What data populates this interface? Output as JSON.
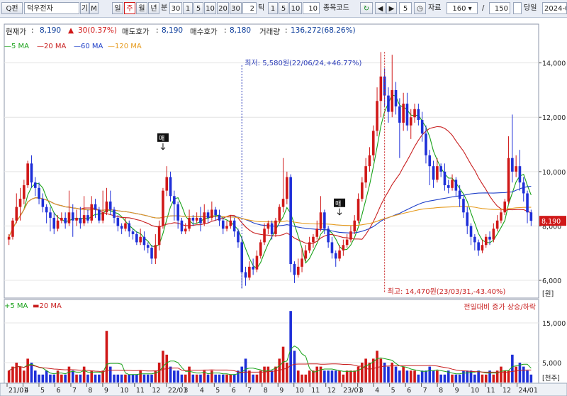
{
  "toolbar": {
    "search_icon_label": "Q펀",
    "stock_name": "덕우전자",
    "btn_gi": "기",
    "btn_m": "M",
    "periods": [
      "일",
      "주",
      "월",
      "년"
    ],
    "active_period": "주",
    "minute_label": "분",
    "minute_value": "30",
    "minute_buttons": [
      "1",
      "5",
      "10",
      "20",
      "30"
    ],
    "tick_value": "2",
    "tick_label": "틱",
    "tick_buttons": [
      "1",
      "5",
      "10"
    ],
    "code_label": "종목코드",
    "step_value": "5",
    "data_label": "자료",
    "data_count": "160",
    "slash": "/",
    "total_count": "150",
    "today_label": "당일",
    "date_value": "2024-0"
  },
  "info": {
    "price_label": "현재가",
    "price_value": "8,190",
    "change_value": "30(0.37%)",
    "ask_label": "매도호가",
    "ask_value": "8,190",
    "bid_label": "매수호가",
    "bid_value": "8,180",
    "volume_label": "거래량",
    "volume_value": "136,272(68.26%)"
  },
  "ma_legend": [
    {
      "label": "5 MA",
      "color": "#1aa21a"
    },
    {
      "label": "20 MA",
      "color": "#c81e1e"
    },
    {
      "label": "60 MA",
      "color": "#1e3fc8"
    },
    {
      "label": "120 MA",
      "color": "#e69b1e"
    }
  ],
  "volume_legend": [
    {
      "label": "5 MA",
      "color": "#1aa21a"
    },
    {
      "label": "20 MA",
      "color": "#c81e1e"
    }
  ],
  "annotations": {
    "low": "최저: 5,580원(22/06/24,+46.77%)",
    "high": "최고: 14,470원(23/03/31,-43.40%)",
    "volume_note": "전일대비 증가 상승/하락",
    "marker": "매"
  },
  "price_axis": {
    "ticks": [
      "14,000",
      "12,000",
      "10,000",
      "8,000",
      "6,000"
    ],
    "unit": "[원]",
    "current": "8,190"
  },
  "volume_axis": {
    "ticks": [
      "15,000",
      "5,000"
    ],
    "unit": "[천주]"
  },
  "x_labels": [
    "21/01",
    "4",
    "5",
    "6",
    "7",
    "8",
    "9",
    "10",
    "11",
    "12",
    "22/01",
    "3",
    "4",
    "5",
    "6",
    "7",
    "8",
    "9",
    "10",
    "11",
    "12",
    "23/01",
    "3",
    "4",
    "5",
    "6",
    "7",
    "8",
    "9",
    "10",
    "11",
    "12",
    "24/01"
  ],
  "colors": {
    "up": "#d01818",
    "down": "#1e2fd8",
    "panel_border": "#8c96a8"
  },
  "chart_data": {
    "type": "candlestick",
    "ylim": [
      5400,
      14800
    ],
    "price_ticks": [
      14000,
      12000,
      10000,
      8000,
      6000
    ],
    "current_price": 8190,
    "candles": [
      [
        7500,
        7600,
        7300,
        7700
      ],
      [
        7600,
        8200,
        7500,
        8300
      ],
      [
        8200,
        8700,
        8100,
        9200
      ],
      [
        8700,
        9000,
        8200,
        9400
      ],
      [
        9000,
        9500,
        8800,
        9700
      ],
      [
        9500,
        10300,
        9400,
        10400
      ],
      [
        10300,
        9600,
        9400,
        10600
      ],
      [
        9600,
        9400,
        9100,
        9800
      ],
      [
        9400,
        9000,
        8800,
        9600
      ],
      [
        9000,
        8700,
        8500,
        9200
      ],
      [
        8700,
        8500,
        8100,
        8800
      ],
      [
        8500,
        8300,
        7800,
        8700
      ],
      [
        8300,
        7900,
        7700,
        8500
      ],
      [
        7900,
        8200,
        7800,
        8400
      ],
      [
        8200,
        8300,
        8100,
        8500
      ],
      [
        8300,
        8100,
        7900,
        8500
      ],
      [
        8100,
        8500,
        8000,
        9300
      ],
      [
        8500,
        8200,
        7600,
        8800
      ],
      [
        8200,
        8300,
        8000,
        8600
      ],
      [
        8300,
        8100,
        7900,
        8700
      ],
      [
        8100,
        8400,
        8000,
        9100
      ],
      [
        8400,
        8200,
        8100,
        8600
      ],
      [
        8200,
        8800,
        8100,
        9100
      ],
      [
        8800,
        8600,
        8300,
        9000
      ],
      [
        8600,
        8200,
        8100,
        8700
      ],
      [
        8200,
        8500,
        8100,
        9300
      ],
      [
        8500,
        8900,
        8400,
        9400
      ],
      [
        8900,
        8600,
        8400,
        9300
      ],
      [
        8600,
        8300,
        8100,
        8700
      ],
      [
        8300,
        8000,
        7800,
        8400
      ],
      [
        8000,
        7900,
        7700,
        8100
      ],
      [
        7900,
        8100,
        7800,
        8300
      ],
      [
        8100,
        7800,
        7600,
        8200
      ],
      [
        7800,
        7700,
        7500,
        7900
      ],
      [
        7700,
        7400,
        7300,
        7800
      ],
      [
        7400,
        7600,
        7300,
        7900
      ],
      [
        7600,
        7300,
        7100,
        7800
      ],
      [
        7300,
        7200,
        7000,
        7400
      ],
      [
        7200,
        6800,
        6600,
        7300
      ],
      [
        6800,
        7300,
        6600,
        7700
      ],
      [
        7300,
        8000,
        7100,
        8200
      ],
      [
        8000,
        9300,
        7900,
        9400
      ],
      [
        9300,
        9800,
        9100,
        10200
      ],
      [
        9800,
        9100,
        8900,
        10000
      ],
      [
        9100,
        8800,
        8200,
        9300
      ],
      [
        8800,
        8200,
        7900,
        8900
      ],
      [
        8200,
        7800,
        7700,
        8300
      ],
      [
        7800,
        7900,
        7700,
        8100
      ],
      [
        7900,
        8300,
        7800,
        8600
      ],
      [
        8300,
        8200,
        8000,
        8400
      ],
      [
        8200,
        8300,
        8100,
        8500
      ],
      [
        8300,
        8100,
        7800,
        8700
      ],
      [
        8100,
        8500,
        8000,
        8800
      ],
      [
        8500,
        8300,
        8100,
        8600
      ],
      [
        8300,
        8600,
        8200,
        8900
      ],
      [
        8600,
        8400,
        8200,
        8700
      ],
      [
        8400,
        8200,
        8000,
        8600
      ],
      [
        8200,
        7900,
        7700,
        8300
      ],
      [
        7900,
        8000,
        7800,
        8200
      ],
      [
        8000,
        8200,
        7900,
        8400
      ],
      [
        8200,
        7800,
        7600,
        8300
      ],
      [
        7800,
        7400,
        7200,
        7900
      ],
      [
        7400,
        6300,
        5700,
        7600
      ],
      [
        6300,
        6100,
        5800,
        6500
      ],
      [
        6100,
        6500,
        6000,
        6700
      ],
      [
        6500,
        6400,
        6200,
        6800
      ],
      [
        6400,
        6900,
        6300,
        7100
      ],
      [
        6900,
        7400,
        6800,
        7500
      ],
      [
        7400,
        7900,
        7300,
        8100
      ],
      [
        7900,
        8100,
        7700,
        8200
      ],
      [
        8100,
        7700,
        7500,
        8200
      ],
      [
        7700,
        8200,
        7600,
        8300
      ],
      [
        8200,
        8700,
        8100,
        8800
      ],
      [
        8700,
        9000,
        8500,
        10500
      ],
      [
        9000,
        9800,
        8800,
        10000
      ],
      [
        9800,
        6600,
        6300,
        9900
      ],
      [
        6600,
        6200,
        5900,
        6700
      ],
      [
        6200,
        6500,
        6100,
        6800
      ],
      [
        6500,
        6800,
        6300,
        7200
      ],
      [
        6800,
        7100,
        6700,
        7300
      ],
      [
        7100,
        7400,
        7000,
        7600
      ],
      [
        7400,
        7600,
        7200,
        7700
      ],
      [
        7600,
        7900,
        7500,
        8200
      ],
      [
        7900,
        8500,
        7800,
        9100
      ],
      [
        8500,
        7900,
        7700,
        8600
      ],
      [
        7900,
        7400,
        7200,
        8000
      ],
      [
        7400,
        7000,
        6800,
        7600
      ],
      [
        7000,
        6800,
        6500,
        7100
      ],
      [
        6800,
        7100,
        6700,
        7300
      ],
      [
        7100,
        7300,
        6900,
        7500
      ],
      [
        7300,
        7500,
        7200,
        7700
      ],
      [
        7500,
        7800,
        7400,
        8000
      ],
      [
        7800,
        8200,
        7700,
        8400
      ],
      [
        8200,
        9000,
        8100,
        9200
      ],
      [
        9000,
        9600,
        8900,
        9800
      ],
      [
        9600,
        10200,
        9400,
        10500
      ],
      [
        10200,
        10600,
        10000,
        10900
      ],
      [
        10600,
        11500,
        10400,
        11700
      ],
      [
        11500,
        12600,
        11300,
        13100
      ],
      [
        12600,
        13500,
        12000,
        14400
      ],
      [
        13500,
        12800,
        12400,
        13800
      ],
      [
        12800,
        12200,
        11800,
        13100
      ],
      [
        12200,
        13000,
        12000,
        14300
      ],
      [
        13000,
        12400,
        12100,
        13300
      ],
      [
        12400,
        11800,
        10500,
        12700
      ],
      [
        11800,
        12500,
        11500,
        12900
      ],
      [
        12500,
        11700,
        11500,
        12900
      ],
      [
        11700,
        12000,
        11200,
        12300
      ],
      [
        12000,
        12300,
        11800,
        12500
      ],
      [
        12300,
        11900,
        11700,
        12500
      ],
      [
        11900,
        11400,
        11100,
        12200
      ],
      [
        11400,
        10600,
        10300,
        11700
      ],
      [
        10600,
        10200,
        9500,
        10800
      ],
      [
        10200,
        9700,
        9400,
        10400
      ],
      [
        9700,
        10200,
        9600,
        10500
      ],
      [
        10200,
        10000,
        9800,
        10300
      ],
      [
        10000,
        9500,
        9300,
        10300
      ],
      [
        9500,
        9400,
        9200,
        9700
      ],
      [
        9400,
        9700,
        9300,
        9900
      ],
      [
        9700,
        9300,
        9100,
        9800
      ],
      [
        9300,
        9000,
        8700,
        9500
      ],
      [
        9000,
        8500,
        8300,
        9100
      ],
      [
        8500,
        8000,
        7700,
        8700
      ],
      [
        8000,
        7600,
        7300,
        8100
      ],
      [
        7600,
        7400,
        7100,
        7700
      ],
      [
        7400,
        7100,
        6900,
        7500
      ],
      [
        7100,
        7300,
        7000,
        7500
      ],
      [
        7300,
        7600,
        7200,
        7700
      ],
      [
        7600,
        7500,
        7300,
        7800
      ],
      [
        7500,
        7900,
        7400,
        8100
      ],
      [
        7900,
        8200,
        7800,
        8400
      ],
      [
        8200,
        8500,
        8100,
        8600
      ],
      [
        8500,
        8900,
        8400,
        9000
      ],
      [
        8900,
        10500,
        8800,
        11300
      ],
      [
        10500,
        10000,
        9600,
        12100
      ],
      [
        10000,
        10200,
        9800,
        10600
      ],
      [
        10200,
        9600,
        9300,
        10800
      ],
      [
        9600,
        9200,
        8900,
        9800
      ],
      [
        9200,
        8500,
        8100,
        9300
      ],
      [
        8500,
        8190,
        8000,
        8600
      ]
    ],
    "volume": [
      3,
      4,
      5,
      4,
      3,
      6,
      5,
      3,
      2,
      2,
      3,
      2,
      2,
      3,
      2,
      2,
      4,
      3,
      2,
      2,
      4,
      2,
      3,
      2,
      2,
      3,
      13,
      4,
      2,
      2,
      2,
      2,
      2,
      2,
      2,
      3,
      2,
      2,
      2,
      3,
      5,
      8,
      7,
      4,
      3,
      3,
      2,
      2,
      4,
      2,
      2,
      2,
      3,
      2,
      3,
      2,
      2,
      2,
      2,
      2,
      2,
      3,
      4,
      6,
      3,
      2,
      2,
      3,
      4,
      4,
      3,
      4,
      6,
      9,
      5,
      18,
      8,
      3,
      2,
      2,
      3,
      3,
      4,
      4,
      3,
      3,
      3,
      3,
      3,
      2,
      3,
      3,
      3,
      4,
      5,
      6,
      5,
      6,
      8,
      6,
      5,
      4,
      5,
      4,
      3,
      4,
      3,
      3,
      3,
      2,
      3,
      3,
      4,
      3,
      3,
      2,
      2,
      3,
      2,
      2,
      2,
      3,
      3,
      3,
      2,
      3,
      2,
      2,
      3,
      2,
      3,
      4,
      3,
      3,
      7,
      4,
      5,
      4,
      3,
      2
    ],
    "volume_ticks": [
      15000,
      5000
    ]
  }
}
